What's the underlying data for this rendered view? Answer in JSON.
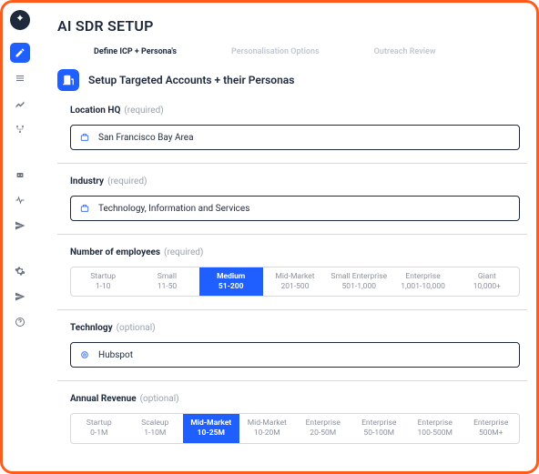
{
  "app": {
    "title": "AI SDR SETUP"
  },
  "steps": [
    {
      "label": "Define ICP + Persona's",
      "active": true
    },
    {
      "label": "Personalisation Options",
      "active": false
    },
    {
      "label": "Outreach Review",
      "active": false
    }
  ],
  "section": {
    "title": "Setup Targeted Accounts + their Personas"
  },
  "fields": {
    "location": {
      "label": "Location HQ",
      "hint": "(required)",
      "value": "San Francisco Bay Area"
    },
    "industry": {
      "label": "Industry",
      "hint": "(required)",
      "value": "Technology, Information and Services"
    },
    "employees": {
      "label": "Number of employees",
      "hint": "(required)",
      "options": [
        {
          "title": "Startup",
          "range": "1-10"
        },
        {
          "title": "Small",
          "range": "11-50"
        },
        {
          "title": "Medium",
          "range": "51-200",
          "active": true
        },
        {
          "title": "Mid-Market",
          "range": "201-500"
        },
        {
          "title": "Small Enterprise",
          "range": "501-1,000"
        },
        {
          "title": "Enterprise",
          "range": "1,001-10,000"
        },
        {
          "title": "Giant",
          "range": "10,000+"
        }
      ]
    },
    "technology": {
      "label": "Technlogy",
      "hint": "(optional)",
      "value": "Hubspot"
    },
    "revenue": {
      "label": "Annual Revenue",
      "hint": "(optional)",
      "options": [
        {
          "title": "Startup",
          "range": "0-1M"
        },
        {
          "title": "Scaleup",
          "range": "1-10M"
        },
        {
          "title": "Mid-Market",
          "range": "10-25M",
          "active": true
        },
        {
          "title": "Mid-Market",
          "range": "10-20M"
        },
        {
          "title": "Enterprise",
          "range": "20-50M"
        },
        {
          "title": "Enterprise",
          "range": "50-100M"
        },
        {
          "title": "Enterprise",
          "range": "100-500M"
        },
        {
          "title": "Enterprise",
          "range": "500M+"
        }
      ]
    }
  }
}
